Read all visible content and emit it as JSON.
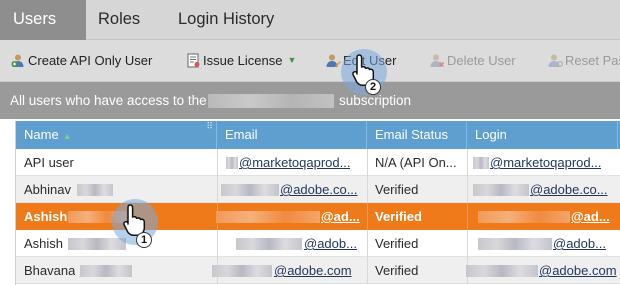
{
  "tabs": [
    {
      "label": "Users",
      "active": true
    },
    {
      "label": "Roles",
      "active": false
    },
    {
      "label": "Login History",
      "active": false
    }
  ],
  "toolbar": {
    "create_api_user": "Create API Only User",
    "issue_license": "Issue License",
    "edit_user": "Edit User",
    "delete_user": "Delete User",
    "reset_password": "Reset Pas"
  },
  "banner": {
    "prefix": "All users who have access to the",
    "suffix": "subscription"
  },
  "table": {
    "columns": [
      "Name",
      "Email",
      "Email Status",
      "Login"
    ],
    "rows": [
      {
        "name": "API user",
        "email": "@marketoqaprod...",
        "status": "N/A (API On...",
        "login": "@marketoqaprod..."
      },
      {
        "name": "Abhinav",
        "email": "@adobe.co...",
        "status": "Verified",
        "login": "@adobe.co..."
      },
      {
        "name": "Ashish",
        "email": "@ad...",
        "status": "Verified",
        "login": "@ad..."
      },
      {
        "name": "Ashish",
        "email": "@adob...",
        "status": "Verified",
        "login": "@adob..."
      },
      {
        "name": "Bhavana",
        "email": "@adobe.com",
        "status": "Verified",
        "login": "@adobe.com"
      }
    ]
  },
  "cursor_badges": {
    "first": "1",
    "second": "2"
  },
  "colors": {
    "selected_row": "#ef7a1a",
    "header": "#5e9fcf",
    "banner": "#9a9a9a"
  }
}
